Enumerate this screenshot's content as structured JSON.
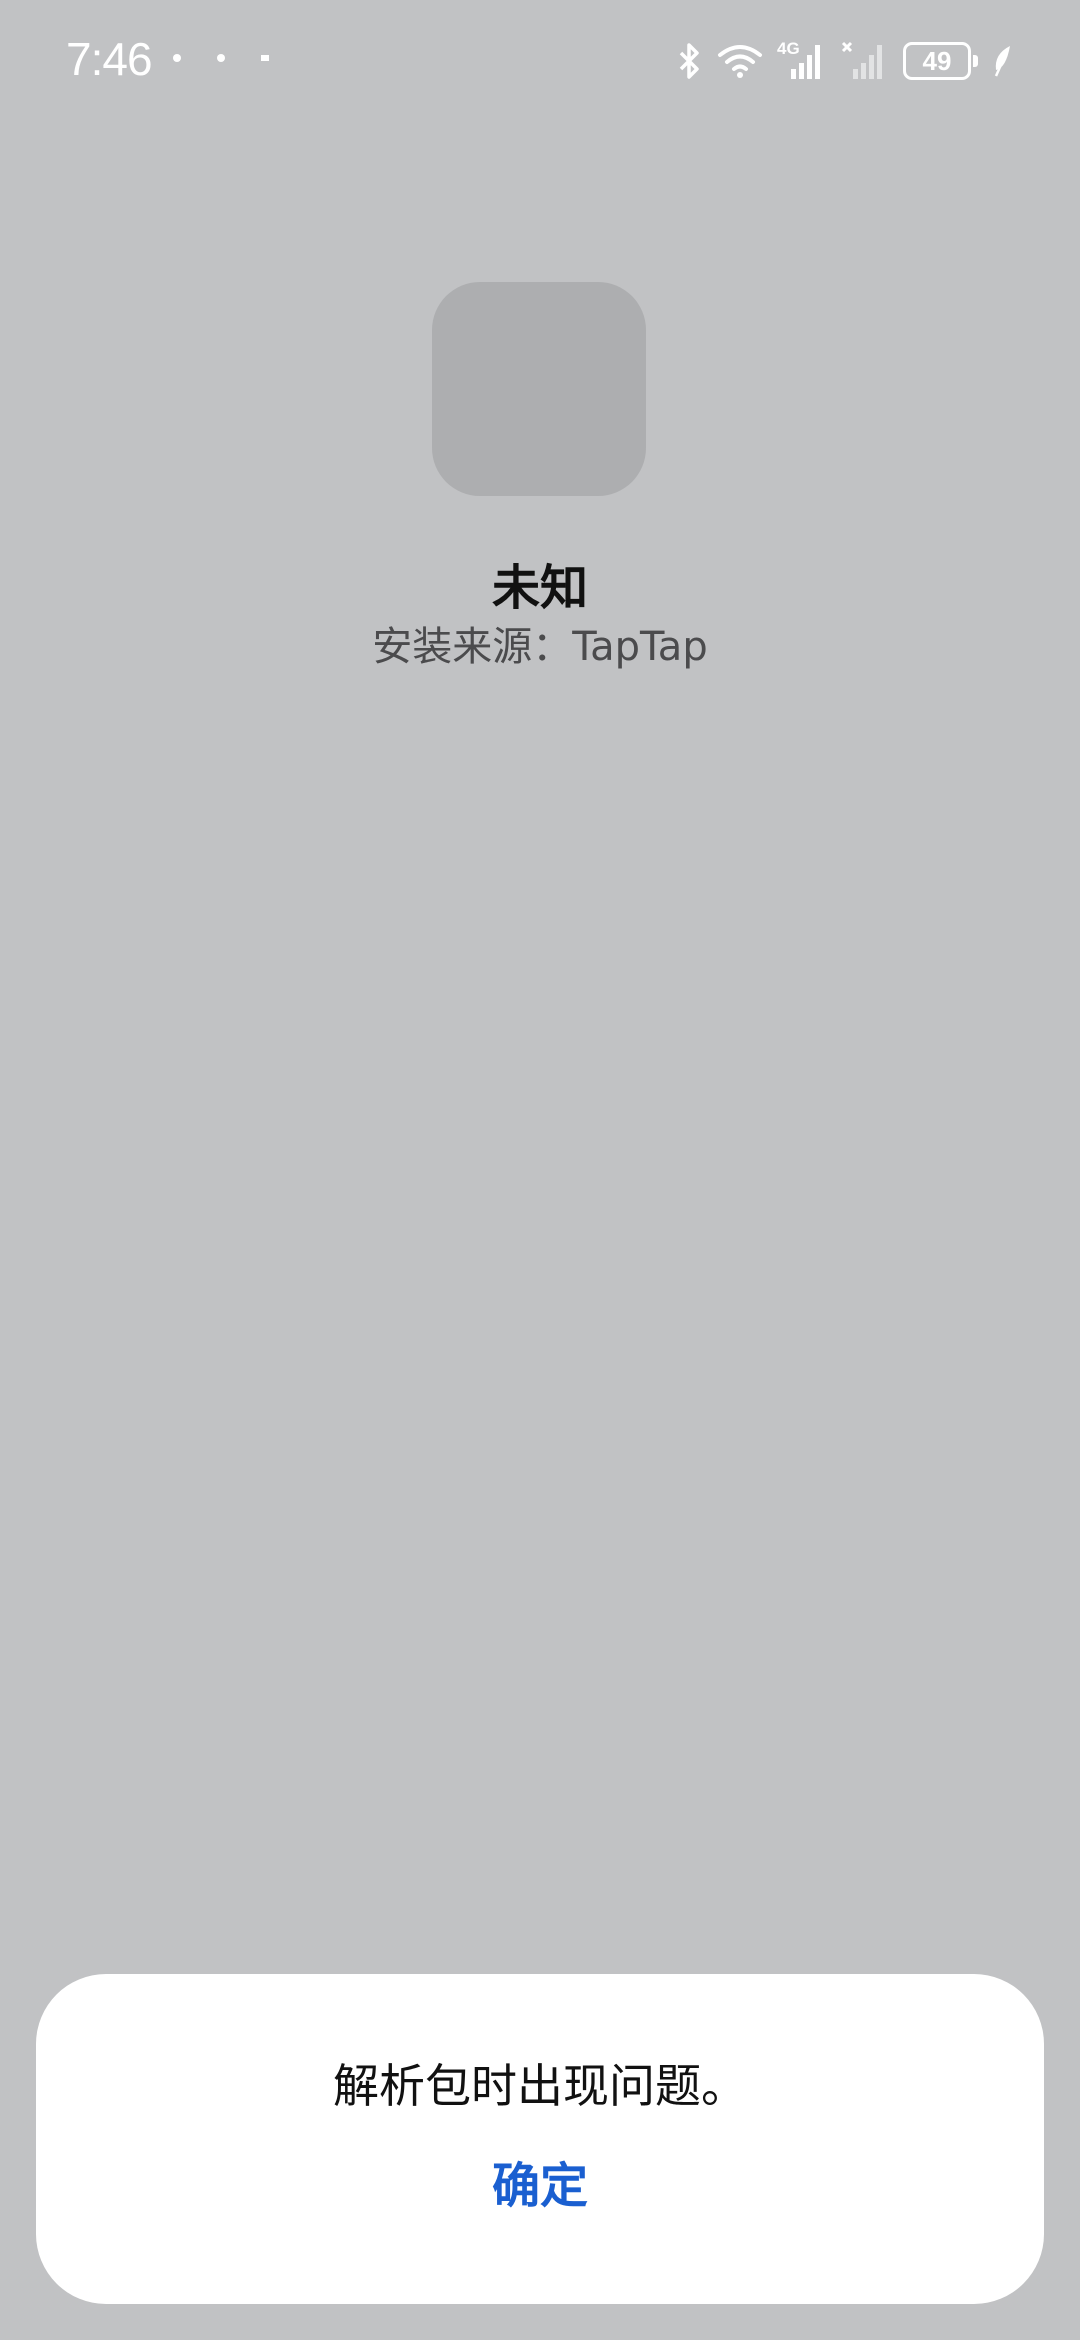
{
  "status_bar": {
    "time": "7:46",
    "battery_level": "49",
    "network_label": "4G",
    "icons": [
      "notification-dot-icon",
      "notification-dot-icon",
      "notification-dot-icon",
      "bluetooth-icon",
      "wifi-icon",
      "signal-4g-icon",
      "signal-no-sim-icon",
      "battery-icon",
      "leaf-icon"
    ]
  },
  "app": {
    "name": "未知",
    "install_source": "安装来源：TapTap"
  },
  "dialog": {
    "message": "解析包时出现问题。",
    "confirm_label": "确定"
  },
  "colors": {
    "background": "#c1c2c4",
    "icon_placeholder": "#adaeb0",
    "accent": "#1a5fd0"
  }
}
